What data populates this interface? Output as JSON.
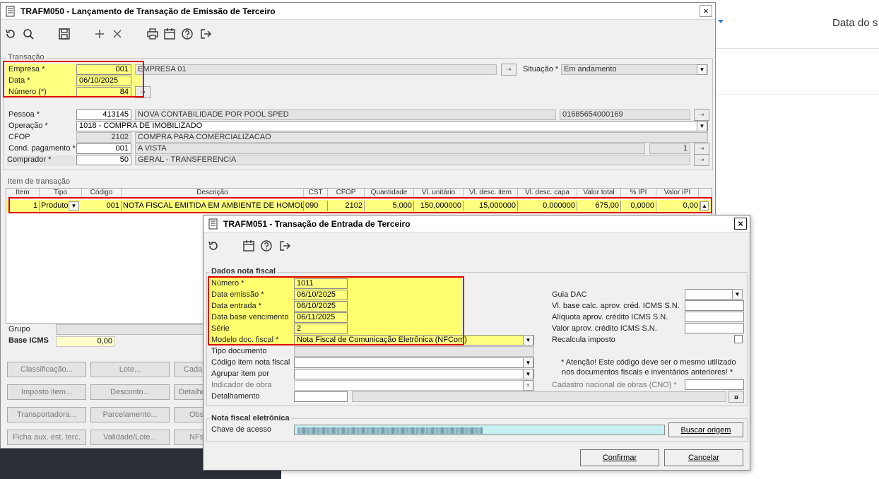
{
  "background_app": {
    "header_text": "Data do s",
    "dropdown_arrow": "caret-down-icon"
  },
  "main_window": {
    "title": "TRAFM050 - Lançamento de Transação de Emissão de Terceiro",
    "close": "×",
    "transacao": {
      "legend": "Transação",
      "empresa_label": "Empresa *",
      "empresa_value": "001",
      "empresa_name": "EMPRESA 01",
      "situacao_label": "Situação *",
      "situacao_value": "Em andamento",
      "data_label": "Data *",
      "data_value": "06/10/2025",
      "numero_label": "Número (*)",
      "numero_value": "84",
      "pessoa_label": "Pessoa *",
      "pessoa_code": "413145",
      "pessoa_name": "NOVA CONTABILIDADE POR POOL SPED",
      "pessoa_doc": "01685654000169",
      "operacao_label": "Operação *",
      "operacao_value": "1018 - COMPRA DE IMOBILIZADO",
      "cfop_label": "CFOP",
      "cfop_code": "2102",
      "cfop_desc": "COMPRA PARA COMERCIALIZACAO",
      "cond_label": "Cond. pagamento *",
      "cond_code": "001",
      "cond_desc": "A VISTA",
      "cond_num": "1",
      "comprador_label": "Comprador *",
      "comprador_code": "50",
      "comprador_desc": "GERAL - TRANSFERENCIA"
    },
    "item": {
      "legend": "Item de transação",
      "columns": [
        "Item",
        "Tipo",
        "Código",
        "Descrição",
        "CST",
        "CFOP",
        "Quantidade",
        "Vl. unitário",
        "Vl. desc. item",
        "Vl. desc. capa",
        "Valor total",
        "% IPI",
        "Valor IPI"
      ],
      "row": {
        "item": "1",
        "tipo": "Produto",
        "codigo": "001",
        "descricao": "NOTA FISCAL EMITIDA EM AMBIENTE DE HOMOLOGA",
        "cst": "090",
        "cfop": "2102",
        "quantidade": "5,000",
        "vl_unitario": "150,000000",
        "vl_desc_item": "15,000000",
        "vl_desc_capa": "0,000000",
        "valor_total": "675,00",
        "pct_ipi": "0,0000",
        "valor_ipi": "0,00"
      }
    },
    "grupo_label": "Grupo",
    "base_icms_label": "Base ICMS",
    "base_icms_value": "0,00",
    "buttons": [
      [
        "Classificação...",
        "Lote...",
        "Cada"
      ],
      [
        "Imposto item...",
        "Desconto...",
        "Detalhe"
      ],
      [
        "Transportadora...",
        "Parcelamento...",
        "Obs"
      ],
      [
        "Ficha aux. est. terc.",
        "Validade/Lote...",
        "NFs"
      ]
    ]
  },
  "dialog": {
    "title": "TRAFM051 - Transação de Entrada de Terceiro",
    "close": "×",
    "dados": {
      "legend": "Dados nota fiscal",
      "numero_label": "Número *",
      "numero_value": "1011",
      "emissao_label": "Data emissão *",
      "emissao_value": "06/10/2025",
      "entrada_label": "Data entrada *",
      "entrada_value": "06/10/2025",
      "vencimento_label": "Data base vencimento",
      "vencimento_value": "06/11/2025",
      "serie_label": "Série",
      "serie_value": "2",
      "modelo_label": "Modelo doc. fiscal *",
      "modelo_value": "Nota Fiscal de Comunicação Eletrônica (NFCom)",
      "tipo_doc_label": "Tipo documento",
      "codigo_item_label": "Código item nota fiscal",
      "agrupar_label": "Agrupar item por",
      "indicador_label": "Indicador de obra",
      "detalhamento_label": "Detalhamento",
      "guia_label": "Guia DAC",
      "vl_base_label": "Vl. base calc. aprov. créd. ICMS S.N.",
      "aliquota_label": "Alíquota aprov. crédito ICMS S.N.",
      "valor_aprov_label": "Valor aprov. crédito ICMS S.N.",
      "recalcula_label": "Recalcula imposto",
      "atencao_line1": "* Atenção! Este código deve ser o mesmo utilizado",
      "atencao_line2": "nos documentos fiscais e inventários anteriores! *",
      "cno_label": "Cadastro nacional de obras (CNO) *",
      "detalhe_btn": "»"
    },
    "nfe": {
      "legend": "Nota fiscal eletrônica",
      "chave_label": "Chave de acesso",
      "buscar_label": "Buscar origem"
    },
    "confirmar_label": "Confirmar",
    "cancelar_label": "Cancelar"
  },
  "colors": {
    "highlight": "#e00000",
    "field_yellow": "#ffff80",
    "field_cyan": "#c8f0f0",
    "background_dark": "#2b2f38"
  }
}
